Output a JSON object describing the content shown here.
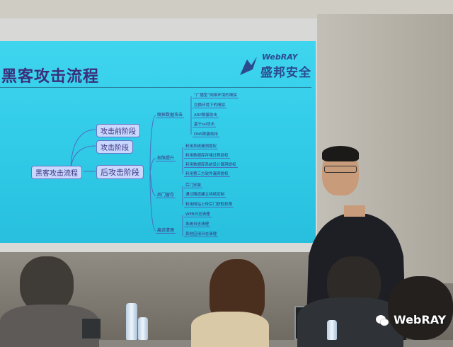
{
  "slide": {
    "title": "黑客攻击流程",
    "logo_brand": "WebRAY",
    "logo_cn": "盛邦安全"
  },
  "mindmap": {
    "root": "黑客攻击流程",
    "phases": [
      "攻击前阶段",
      "攻击阶段",
      "后攻击阶段"
    ],
    "branches": [
      "嗅探数据攻击",
      "权限提升",
      "后门留存",
      "痕迹清理"
    ],
    "leaves_sniff": [
      "“广播型”网络环境的嗅探",
      "交换环境下的嗅探",
      "ARP欺骗攻击",
      "基于ssl攻击",
      "DNS欺骗劫持"
    ],
    "leaves_priv": [
      "利用系统漏洞提权",
      "利用数据库存储过程提权",
      "利用数据库系统设计漏洞提权",
      "利用第三方软件漏洞提权"
    ],
    "leaves_backdoor": [
      "后门安装",
      "通过隧道建立持续控制",
      "利用网站上传后门获取权限"
    ],
    "leaves_clean": [
      "WEB日志清理",
      "系统日志清理",
      "其他应用日志清理"
    ]
  },
  "watermark": {
    "icon": "wechat-icon",
    "text": "WebRAY"
  },
  "colors": {
    "slide_bg": "#2fc9e6",
    "title": "#3b2e7a",
    "node_fill": "#c8d8ff"
  }
}
